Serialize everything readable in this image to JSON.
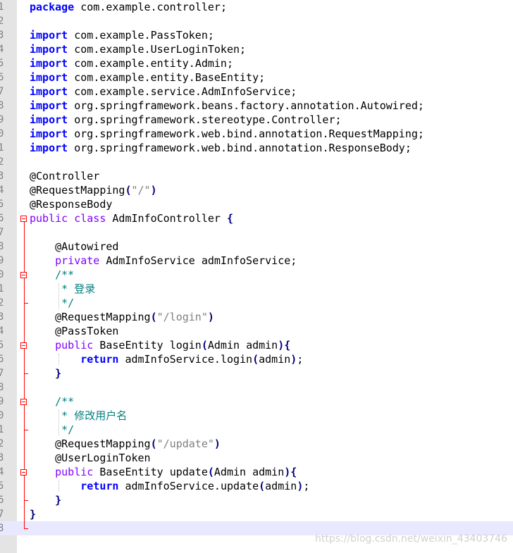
{
  "editor": {
    "lines": [
      {
        "num": "1",
        "text": "package com.example.controller;"
      },
      {
        "num": "2",
        "text": ""
      },
      {
        "num": "3",
        "text": "import com.example.PassToken;"
      },
      {
        "num": "4",
        "text": "import com.example.UserLoginToken;"
      },
      {
        "num": "5",
        "text": "import com.example.entity.Admin;"
      },
      {
        "num": "6",
        "text": "import com.example.entity.BaseEntity;"
      },
      {
        "num": "7",
        "text": "import com.example.service.AdmInfoService;"
      },
      {
        "num": "8",
        "text": "import org.springframework.beans.factory.annotation.Autowired;"
      },
      {
        "num": "9",
        "text": "import org.springframework.stereotype.Controller;"
      },
      {
        "num": "0",
        "text": "import org.springframework.web.bind.annotation.RequestMapping;"
      },
      {
        "num": "1",
        "text": "import org.springframework.web.bind.annotation.ResponseBody;"
      },
      {
        "num": "2",
        "text": ""
      },
      {
        "num": "3",
        "text": "@Controller"
      },
      {
        "num": "4",
        "text": "@RequestMapping(\"/\")"
      },
      {
        "num": "5",
        "text": "@ResponseBody"
      },
      {
        "num": "6",
        "text": "public class AdmInfoController {"
      },
      {
        "num": "7",
        "text": ""
      },
      {
        "num": "8",
        "text": "    @Autowired"
      },
      {
        "num": "9",
        "text": "    private AdmInfoService admInfoService;"
      },
      {
        "num": "0",
        "text": "    /**"
      },
      {
        "num": "1",
        "text": "     * 登录"
      },
      {
        "num": "2",
        "text": "     */"
      },
      {
        "num": "3",
        "text": "    @RequestMapping(\"/login\")"
      },
      {
        "num": "4",
        "text": "    @PassToken"
      },
      {
        "num": "5",
        "text": "    public BaseEntity login(Admin admin){"
      },
      {
        "num": "6",
        "text": "        return admInfoService.login(admin);"
      },
      {
        "num": "7",
        "text": "    }"
      },
      {
        "num": "8",
        "text": ""
      },
      {
        "num": "9",
        "text": "    /**"
      },
      {
        "num": "0",
        "text": "     * 修改用户名"
      },
      {
        "num": "1",
        "text": "     */"
      },
      {
        "num": "2",
        "text": "    @RequestMapping(\"/update\")"
      },
      {
        "num": "3",
        "text": "    @UserLoginToken"
      },
      {
        "num": "4",
        "text": "    public BaseEntity update(Admin admin){"
      },
      {
        "num": "5",
        "text": "        return admInfoService.update(admin);"
      },
      {
        "num": "6",
        "text": "    }"
      },
      {
        "num": "7",
        "text": "}"
      },
      {
        "num": "8",
        "text": ""
      }
    ]
  },
  "watermark": "https://blog.csdn.net/weixin_43403746",
  "colors": {
    "keyword": "#0000ff",
    "modifier": "#8000ff",
    "string": "#808080",
    "comment": "#008080",
    "fold_marker": "#ff0000",
    "gutter": "#e4e4e4",
    "current_line": "#e8e8ff"
  }
}
